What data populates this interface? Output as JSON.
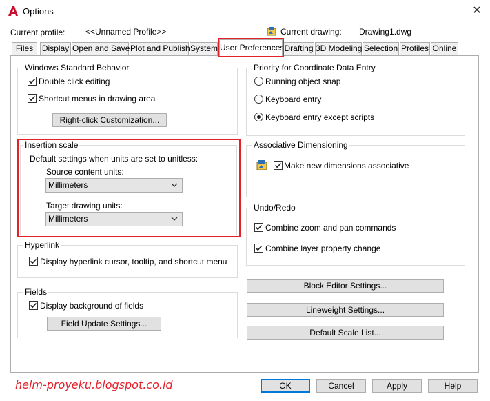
{
  "window": {
    "title": "Options",
    "close_glyph": "✕"
  },
  "header": {
    "current_profile_label": "Current profile:",
    "current_profile_value": "<<Unnamed Profile>>",
    "current_drawing_label": "Current drawing:",
    "current_drawing_value": "Drawing1.dwg"
  },
  "tabs": [
    {
      "label": "Files"
    },
    {
      "label": "Display"
    },
    {
      "label": "Open and Save"
    },
    {
      "label": "Plot and Publish"
    },
    {
      "label": "System"
    },
    {
      "label": "User Preferences",
      "active": true
    },
    {
      "label": "Drafting"
    },
    {
      "label": "3D Modeling"
    },
    {
      "label": "Selection"
    },
    {
      "label": "Profiles"
    },
    {
      "label": "Online"
    }
  ],
  "windows_behavior": {
    "title": "Windows Standard Behavior",
    "double_click_label": "Double click editing",
    "double_click_checked": true,
    "shortcut_menus_label": "Shortcut menus in drawing area",
    "shortcut_menus_checked": true,
    "right_click_button": "Right-click Customization..."
  },
  "insertion_scale": {
    "title": "Insertion scale",
    "description": "Default settings when units are set to unitless:",
    "source_label": "Source content units:",
    "source_value": "Millimeters",
    "target_label": "Target drawing units:",
    "target_value": "Millimeters"
  },
  "hyperlink": {
    "title": "Hyperlink",
    "display_label": "Display hyperlink cursor, tooltip, and shortcut menu",
    "display_checked": true
  },
  "fields": {
    "title": "Fields",
    "background_label": "Display background of fields",
    "background_checked": true,
    "update_button": "Field Update Settings..."
  },
  "coordinate_priority": {
    "title": "Priority for Coordinate Data Entry",
    "options": [
      {
        "label": "Running object snap",
        "selected": false
      },
      {
        "label": "Keyboard entry",
        "selected": false
      },
      {
        "label": "Keyboard entry except scripts",
        "selected": true
      }
    ]
  },
  "assoc_dim": {
    "title": "Associative Dimensioning",
    "label": "Make new dimensions associative",
    "checked": true
  },
  "undo_redo": {
    "title": "Undo/Redo",
    "zoom_pan_label": "Combine zoom and pan commands",
    "zoom_pan_checked": true,
    "layer_label": "Combine layer property change",
    "layer_checked": true
  },
  "right_buttons": {
    "block_editor": "Block Editor Settings...",
    "lineweight": "Lineweight Settings...",
    "scale_list": "Default Scale List..."
  },
  "footer": {
    "watermark": "helm-proyeku.blogspot.co.id",
    "ok": "OK",
    "cancel": "Cancel",
    "apply": "Apply",
    "help": "Help"
  },
  "colors": {
    "highlight_red": "#e4202a",
    "autocad_red": "#c8102e",
    "default_button_blue": "#0078d7"
  }
}
